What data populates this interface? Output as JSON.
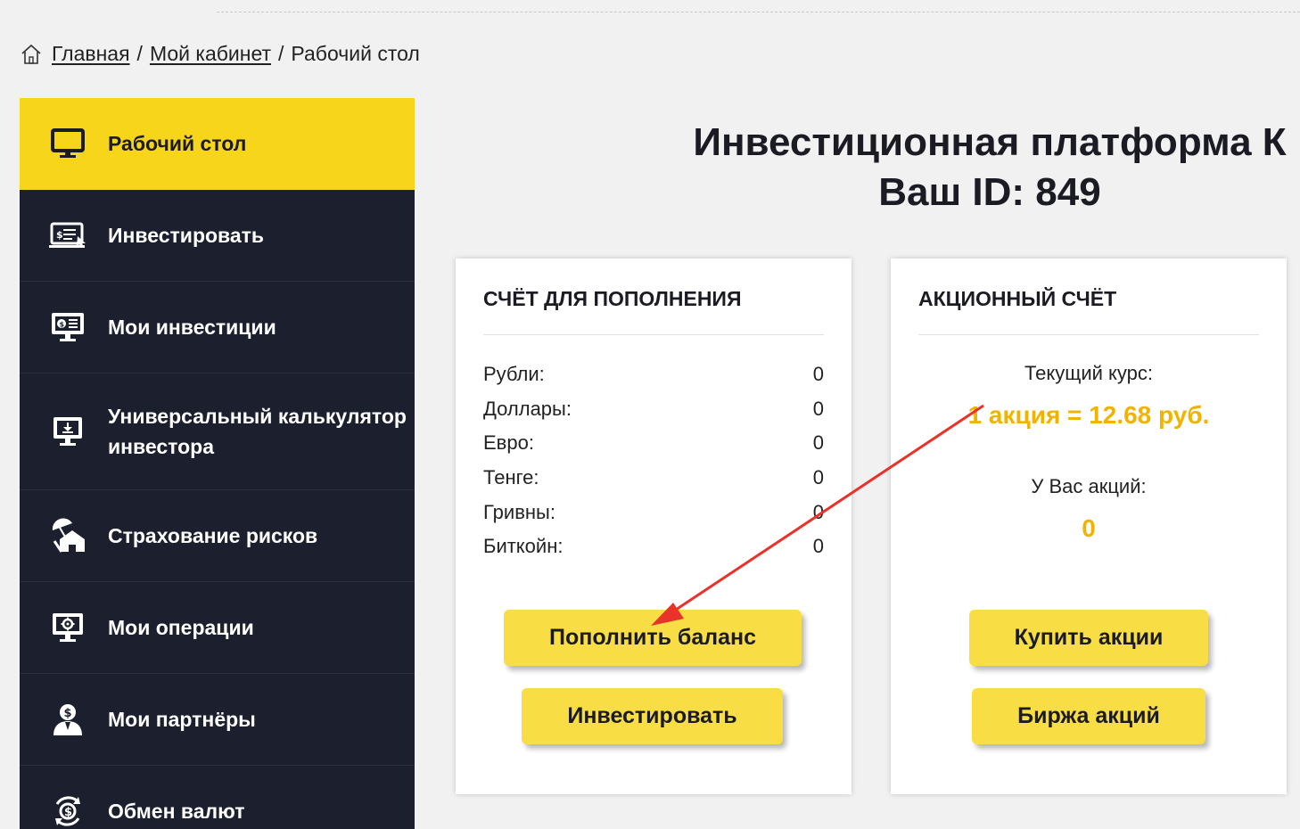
{
  "breadcrumb": {
    "home": "Главная",
    "sep1": "/",
    "cabinet": "Мой кабинет",
    "sep2": "/",
    "current": "Рабочий стол"
  },
  "sidebar": {
    "items": [
      {
        "label": "Рабочий стол",
        "icon": "monitor-icon"
      },
      {
        "label": "Инвестировать",
        "icon": "invest-icon"
      },
      {
        "label": "Мои инвестиции",
        "icon": "investments-icon"
      },
      {
        "label": "Универсальный калькулятор инвестора",
        "icon": "calculator-icon"
      },
      {
        "label": "Страхование рисков",
        "icon": "insurance-icon"
      },
      {
        "label": "Мои операции",
        "icon": "operations-icon"
      },
      {
        "label": "Мои партнёры",
        "icon": "partners-icon"
      },
      {
        "label": "Обмен валют",
        "icon": "exchange-icon"
      }
    ]
  },
  "header": {
    "title_line1": "Инвестиционная платформа К",
    "title_line2": "Ваш ID: 849"
  },
  "deposit_account": {
    "heading": "СЧЁТ ДЛЯ ПОПОЛНЕНИЯ",
    "rows": [
      {
        "label": "Рубли:",
        "value": "0"
      },
      {
        "label": "Доллары:",
        "value": "0"
      },
      {
        "label": "Евро:",
        "value": "0"
      },
      {
        "label": "Тенге:",
        "value": "0"
      },
      {
        "label": "Гривны:",
        "value": "0"
      },
      {
        "label": "Биткойн:",
        "value": "0"
      }
    ],
    "topup_label": "Пополнить баланс",
    "invest_label": "Инвестировать"
  },
  "share_account": {
    "heading": "АКЦИОННЫЙ СЧЁТ",
    "rate_caption": "Текущий курс:",
    "rate_value": "1 акция = 12.68 руб.",
    "shares_caption": "У Вас акций:",
    "shares_value": "0",
    "buy_label": "Купить акции",
    "exchange_label": "Биржа акций"
  },
  "colors": {
    "accent": "#f6d51a",
    "button": "#f8dd45",
    "sidebar_bg": "#1c1f2e",
    "rate_text": "#f0b400",
    "annotation_arrow": "#e8322a"
  }
}
